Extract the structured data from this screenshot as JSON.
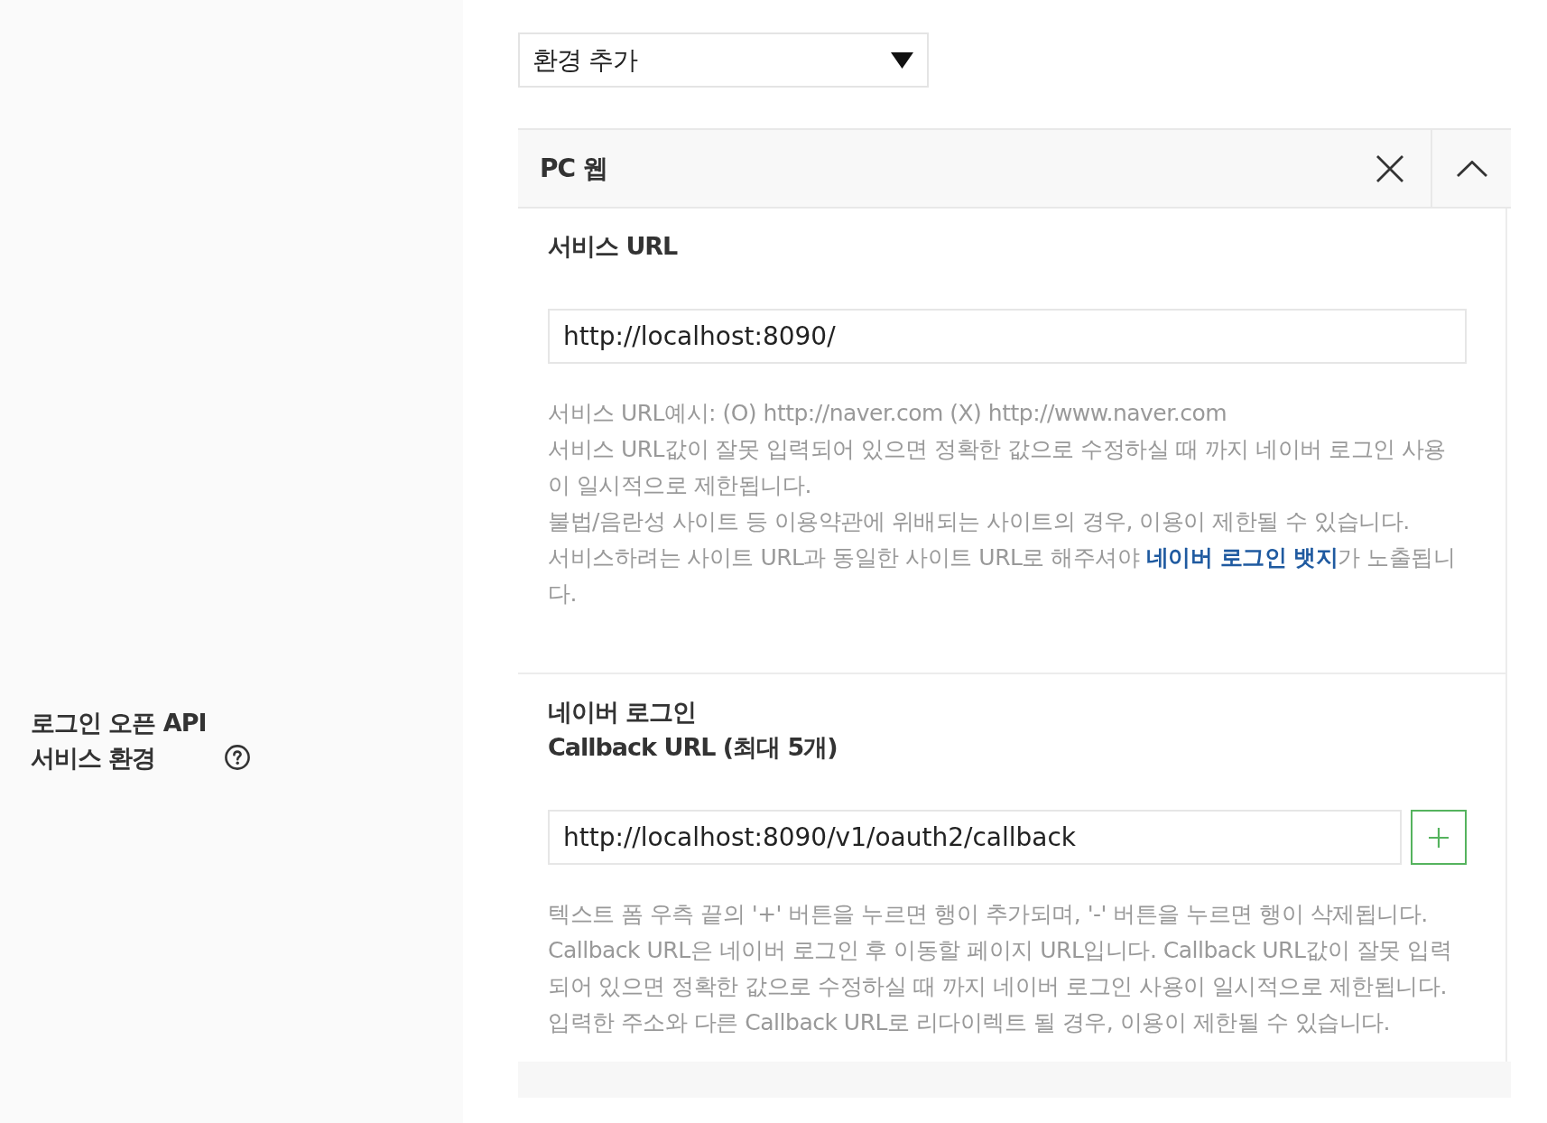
{
  "sidebar": {
    "label_lines": [
      "로그인 오픈 API",
      "서비스 환경"
    ]
  },
  "environment_select": {
    "value": "환경 추가"
  },
  "environment_panel": {
    "title": "PC 웹",
    "expanded": true,
    "sections": [
      {
        "kind": "single",
        "title_lines": [
          "서비스 URL"
        ],
        "fields": [
          {
            "value": "http://localhost:8090/"
          }
        ],
        "help": [
          {
            "text": "서비스 URL예시: (O) http://naver.com (X) http://www.naver.com"
          },
          {
            "text": "서비스 URL값이 잘못 입력되어 있으면 정확한 값으로 수정하실 때 까지 네이버 로그인 사용이 일시적으로 제한됩니다."
          },
          {
            "text": "불법/음란성 사이트 등 이용약관에 위배되는 사이트의 경우, 이용이 제한될 수 있습니다."
          },
          {
            "text": "서비스하려는 사이트 URL과 동일한 사이트 URL로 해주셔야 ",
            "link": "네이버 로그인 뱃지",
            "after": "가 노출됩니다."
          }
        ]
      },
      {
        "kind": "multi",
        "title_lines": [
          "네이버 로그인",
          "Callback URL (최대 5개)"
        ],
        "fields": [
          {
            "value": "http://localhost:8090/v1/oauth2/callback"
          }
        ],
        "help": [
          {
            "text": "텍스트 폼 우측 끝의 '+' 버튼을 누르면 행이 추가되며, '-' 버튼을 누르면 행이 삭제됩니다."
          },
          {
            "text": "Callback URL은 네이버 로그인 후 이동할 페이지 URL입니다. Callback URL값이 잘못 입력되어 있으면 정확한 값으로 수정하실 때 까지 네이버 로그인 사용이 일시적으로 제한됩니다."
          },
          {
            "text": "입력한 주소와 다른 Callback URL로 리다이렉트 될 경우, 이용이 제한될 수 있습니다."
          }
        ]
      }
    ]
  }
}
